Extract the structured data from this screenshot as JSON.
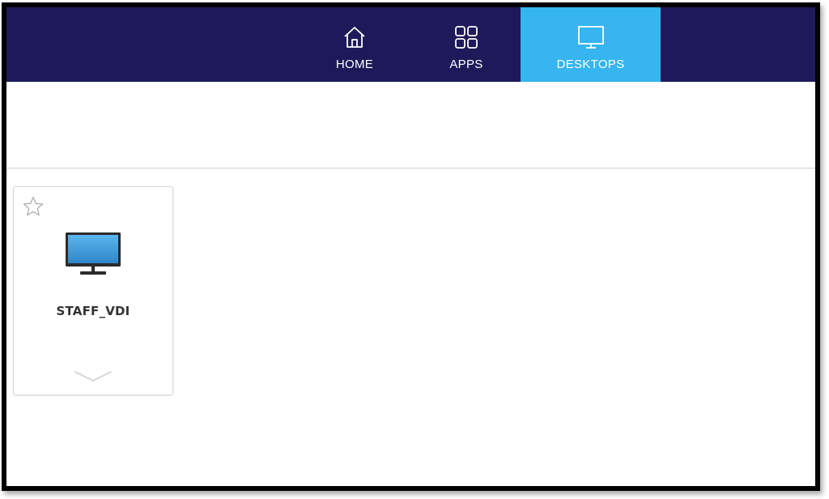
{
  "nav": {
    "tabs": [
      {
        "label": "HOME",
        "icon": "home-icon",
        "active": false
      },
      {
        "label": "APPS",
        "icon": "apps-grid-icon",
        "active": false
      },
      {
        "label": "DESKTOPS",
        "icon": "monitor-icon",
        "active": true
      }
    ]
  },
  "desktops": {
    "items": [
      {
        "name": "STAFF_VDI",
        "icon": "desktop-monitor-icon",
        "favorite": false
      }
    ]
  },
  "colors": {
    "topbar": "#1e1a5a",
    "active_tab": "#36b5f0",
    "tile_text": "#333333",
    "monitor_screen": "#3a9ad9"
  }
}
